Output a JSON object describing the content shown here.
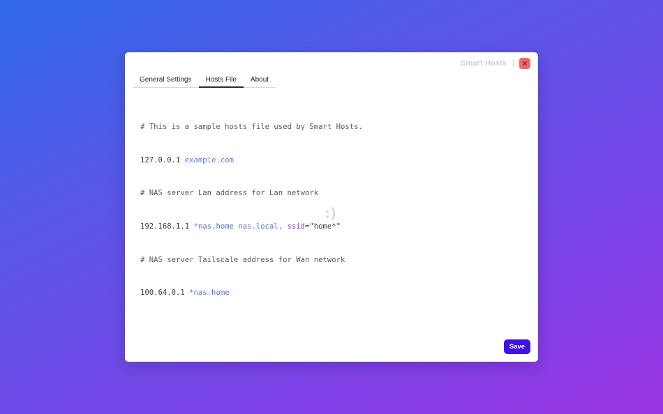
{
  "window": {
    "app_title": "Smart Hosts",
    "close_icon": "close-icon"
  },
  "tabs": [
    {
      "label": "General Settings",
      "active": false
    },
    {
      "label": "Hosts File",
      "active": true
    },
    {
      "label": "About",
      "active": false
    }
  ],
  "editor": {
    "lines": [
      {
        "comment": "# This is a sample hosts file used by Smart Hosts."
      },
      {
        "ip": "127.0.0.1",
        "hosts": "example.com"
      },
      {
        "comment": "# NAS server Lan address for Lan network"
      },
      {
        "ip": "192.168.1.1",
        "hosts": "*nas.home nas.local,",
        "key": "ssid",
        "op": "=",
        "value": "\"home*\""
      },
      {
        "comment": "# NAS server Tailscale address for Wan network"
      },
      {
        "ip": "100.64.0.1",
        "hosts": "*nas.home"
      }
    ]
  },
  "empty_indicator": ":)",
  "footer": {
    "save_label": "Save"
  },
  "colors": {
    "accent": "#3f12e6",
    "close": "#f2686a",
    "host_token": "#5b74e0",
    "key_token": "#8a3fd6"
  }
}
